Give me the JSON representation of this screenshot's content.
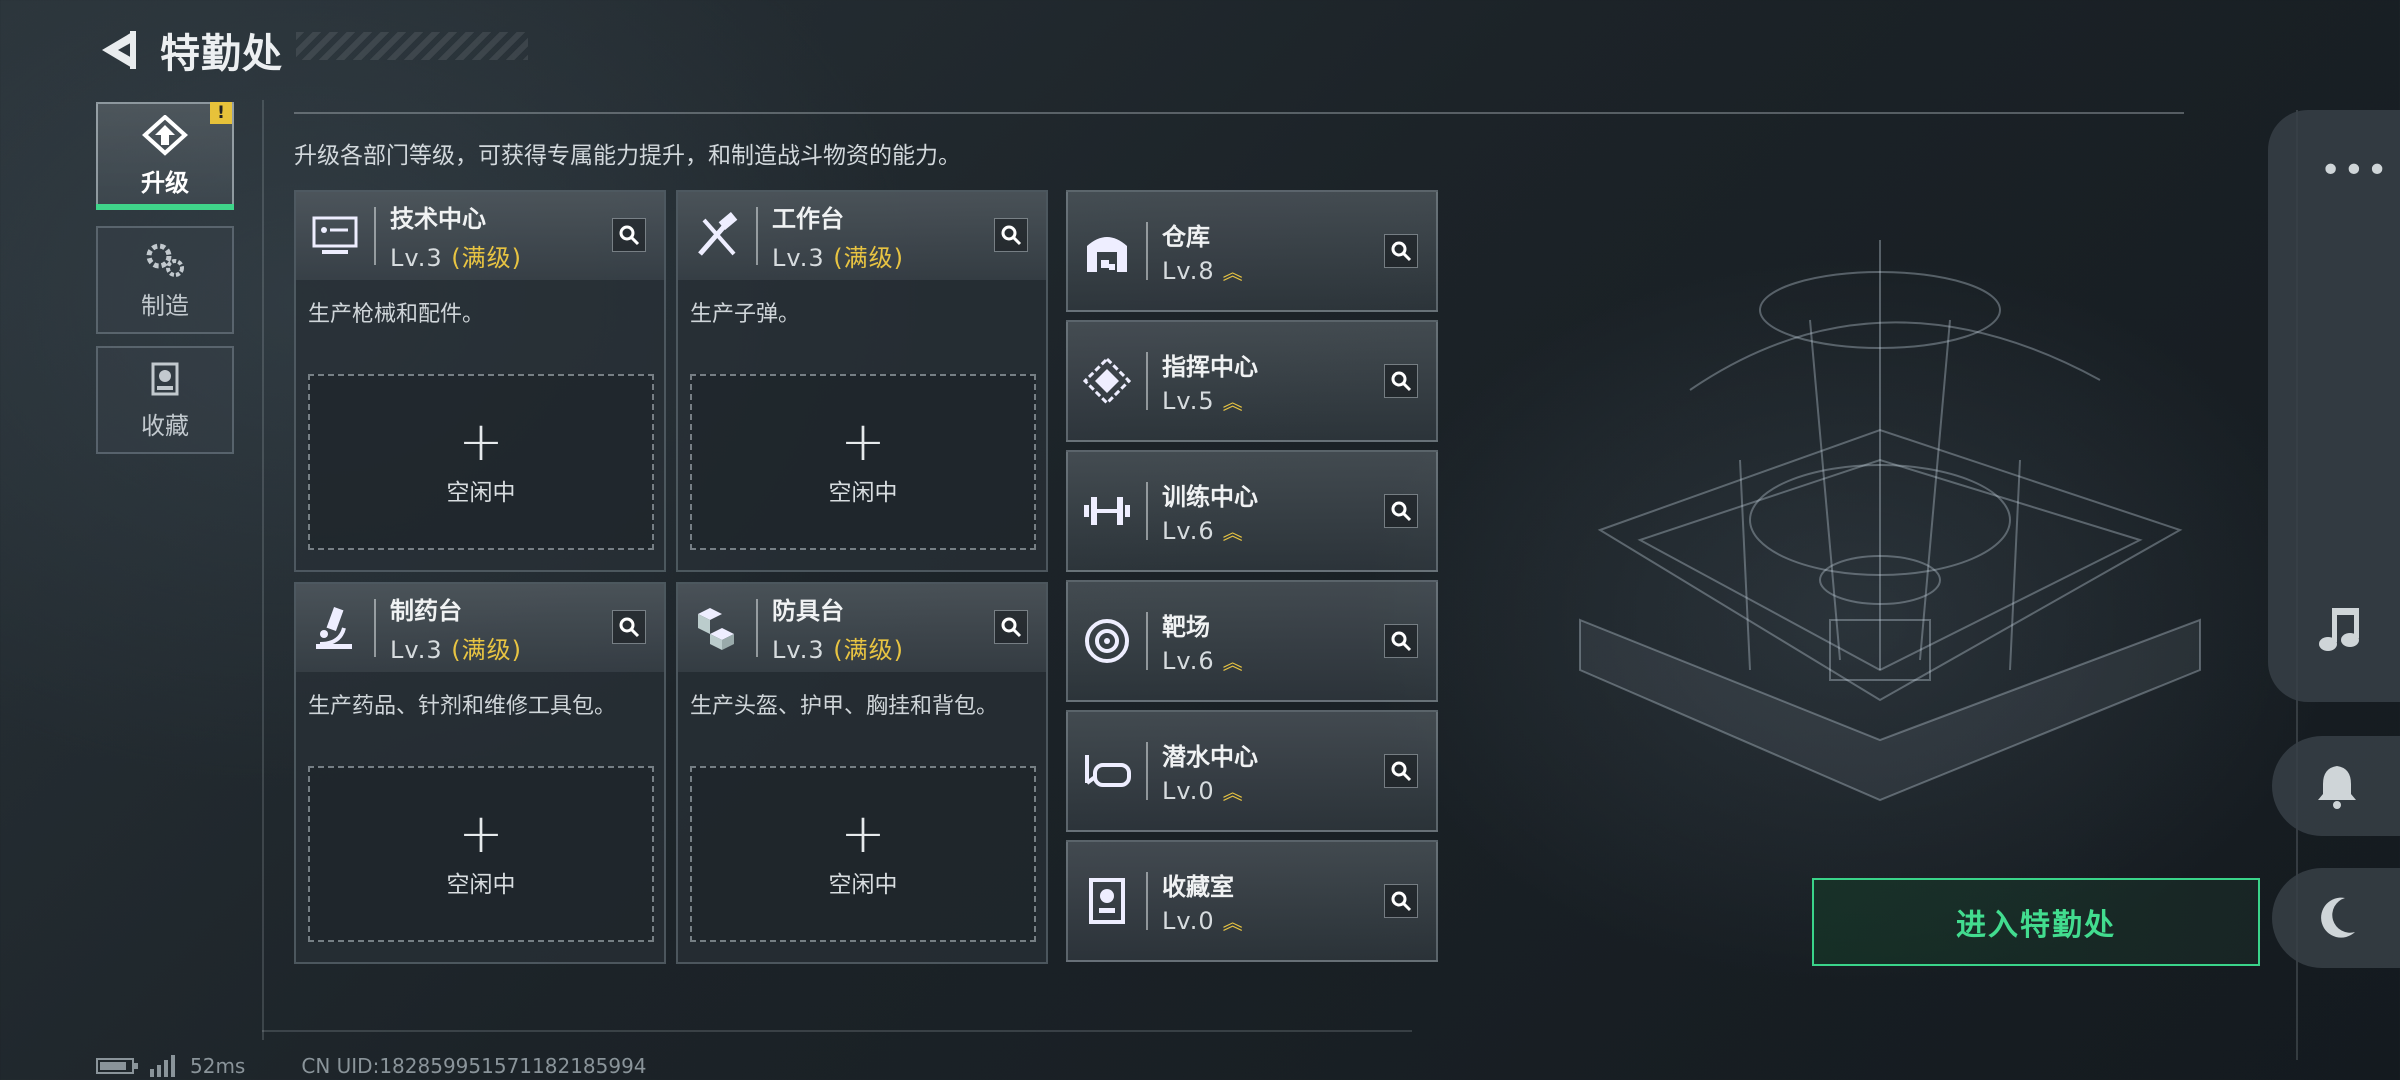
{
  "header": {
    "title": "特勤处"
  },
  "tabs": [
    {
      "label": "升级",
      "icon": "upgrade-icon",
      "active": true,
      "alert": "!"
    },
    {
      "label": "制造",
      "icon": "gears-icon",
      "active": false
    },
    {
      "label": "收藏",
      "icon": "trophy-icon",
      "active": false
    }
  ],
  "description": "升级各部门等级，可获得专属能力提升，和制造战斗物资的能力。",
  "facilities": [
    {
      "name": "技术中心",
      "level": "Lv.3",
      "max": "(满级)",
      "desc": "生产枪械和配件。",
      "slot": "空闲中",
      "icon": "computer-icon"
    },
    {
      "name": "工作台",
      "level": "Lv.3",
      "max": "(满级)",
      "desc": "生产子弹。",
      "slot": "空闲中",
      "icon": "tools-icon"
    },
    {
      "name": "制药台",
      "level": "Lv.3",
      "max": "(满级)",
      "desc": "生产药品、针剂和维修工具包。",
      "slot": "空闲中",
      "icon": "microscope-icon"
    },
    {
      "name": "防具台",
      "level": "Lv.3",
      "max": "(满级)",
      "desc": "生产头盔、护甲、胸挂和背包。",
      "slot": "空闲中",
      "icon": "cubes-icon"
    }
  ],
  "departments": [
    {
      "name": "仓库",
      "level": "Lv.8",
      "icon": "warehouse-icon"
    },
    {
      "name": "指挥中心",
      "level": "Lv.5",
      "icon": "command-icon"
    },
    {
      "name": "训练中心",
      "level": "Lv.6",
      "icon": "dumbbell-icon"
    },
    {
      "name": "靶场",
      "level": "Lv.6",
      "icon": "target-icon"
    },
    {
      "name": "潜水中心",
      "level": "Lv.0",
      "icon": "diving-mask-icon"
    },
    {
      "name": "收藏室",
      "level": "Lv.0",
      "icon": "trophy-case-icon"
    }
  ],
  "enter_button": "进入特勤处",
  "footer": {
    "ping": "52ms",
    "uid": "CN UID:182859951571182185994"
  },
  "colors": {
    "accent_green": "#3ad48a",
    "max_gold": "#e8c442",
    "alert_yellow": "#e7c23a"
  }
}
